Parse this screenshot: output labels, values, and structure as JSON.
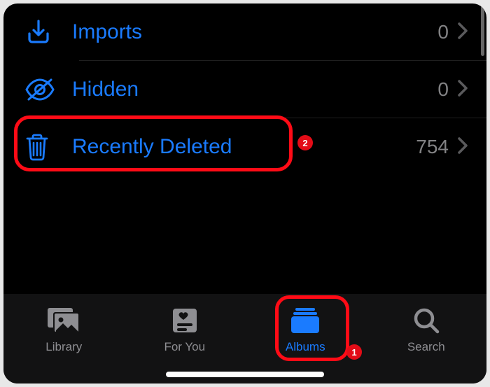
{
  "albums": {
    "imports": {
      "label": "Imports",
      "count": "0"
    },
    "hidden": {
      "label": "Hidden",
      "count": "0"
    },
    "deleted": {
      "label": "Recently Deleted",
      "count": "754"
    }
  },
  "tabs": {
    "library": "Library",
    "foryou": "For You",
    "albums": "Albums",
    "search": "Search"
  },
  "annotations": {
    "badge1": "1",
    "badge2": "2"
  },
  "colors": {
    "accent": "#1a7bff",
    "highlight": "#ff0b16",
    "secondary": "#8e8e92"
  }
}
